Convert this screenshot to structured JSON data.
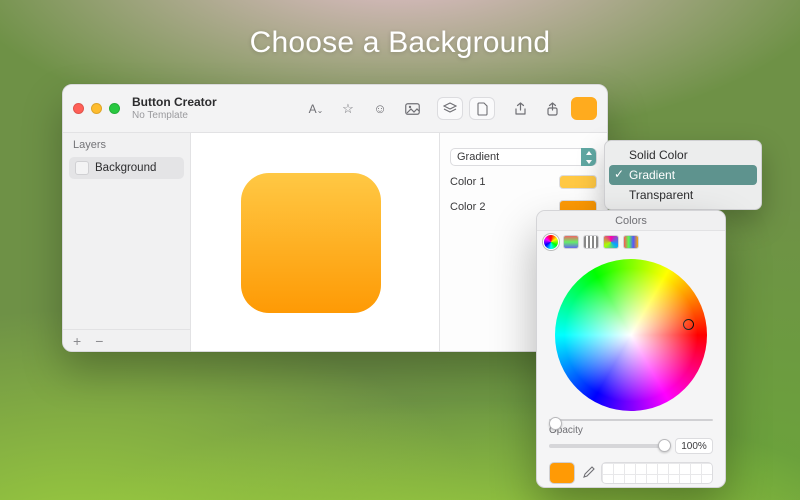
{
  "headline": "Choose a Background",
  "app": {
    "title": "Button Creator",
    "subtitle": "No Template",
    "toolbar_icons": [
      "text-icon",
      "star-icon",
      "smiley-icon",
      "image-icon",
      "layers-icon",
      "document-icon",
      "export-icon",
      "share-icon",
      "color-chip-icon"
    ]
  },
  "sidebar": {
    "header": "Layers",
    "items": [
      {
        "label": "Background"
      }
    ],
    "footer": {
      "add": "+",
      "remove": "−"
    }
  },
  "inspector": {
    "type_label": "Gradient",
    "rows": [
      {
        "label": "Color 1",
        "color": "#ffc844"
      },
      {
        "label": "Color 2",
        "color": "#fe9a05"
      }
    ]
  },
  "artboard": {
    "gradient_top": "#ffc844",
    "gradient_bottom": "#fe9a05"
  },
  "menu": {
    "items": [
      {
        "label": "Solid Color",
        "checked": false
      },
      {
        "label": "Gradient",
        "checked": true
      },
      {
        "label": "Transparent",
        "checked": false
      }
    ]
  },
  "picker": {
    "title": "Colors",
    "opacity_label": "Opacity",
    "opacity_value": "100%",
    "selected_color": "#ff9a05"
  }
}
